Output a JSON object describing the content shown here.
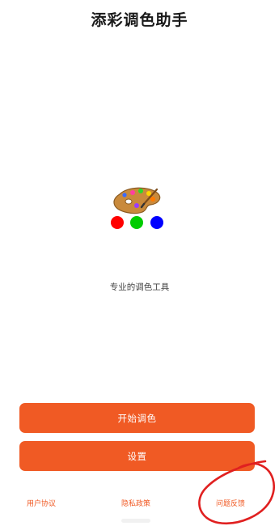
{
  "app": {
    "title": "添彩调色助手",
    "tagline": "专业的调色工具"
  },
  "logo": {
    "icon": "palette-icon",
    "dots": [
      "#ff0000",
      "#00cc00",
      "#0000ff"
    ]
  },
  "actions": {
    "start_label": "开始调色",
    "settings_label": "设置"
  },
  "footer": {
    "user_agreement": "用户协议",
    "privacy_policy": "隐私政策",
    "feedback": "问题反馈"
  },
  "colors": {
    "accent": "#f05a24",
    "annotation": "#e02020"
  }
}
